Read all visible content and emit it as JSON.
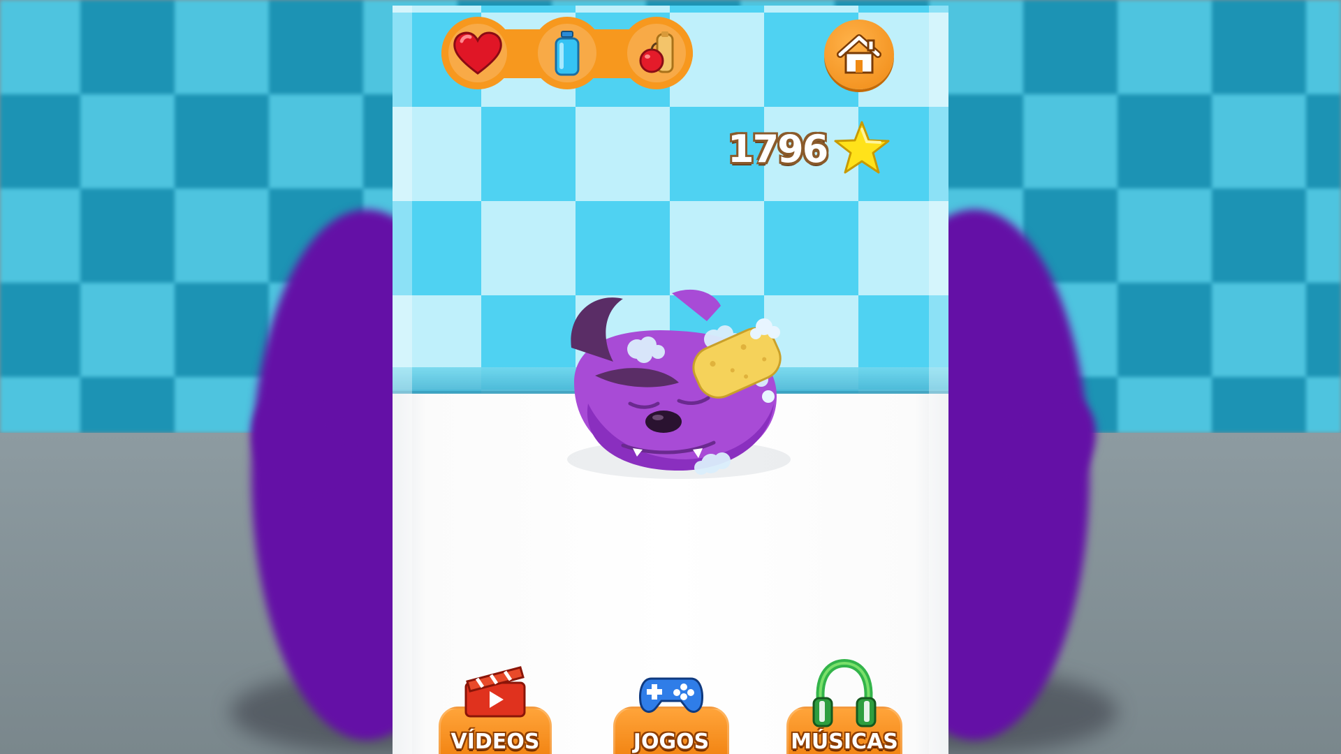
{
  "score": {
    "value": "1796",
    "icon": "star-icon"
  },
  "status_icons": [
    {
      "name": "heart-icon",
      "meaning": "love"
    },
    {
      "name": "water-bottle-icon",
      "meaning": "hygiene"
    },
    {
      "name": "apple-bottle-icon",
      "meaning": "food"
    }
  ],
  "home": {
    "icon": "home-icon"
  },
  "menu": {
    "videos_label": "VÍDEOS",
    "jogos_label": "JOGOS",
    "musicas_label": "MÚSICAS"
  },
  "colors": {
    "orange": "#f7981e",
    "tile_light": "#bff0fb",
    "tile_dark": "#4fd2f2",
    "pet_purple": "#a84bd6"
  }
}
